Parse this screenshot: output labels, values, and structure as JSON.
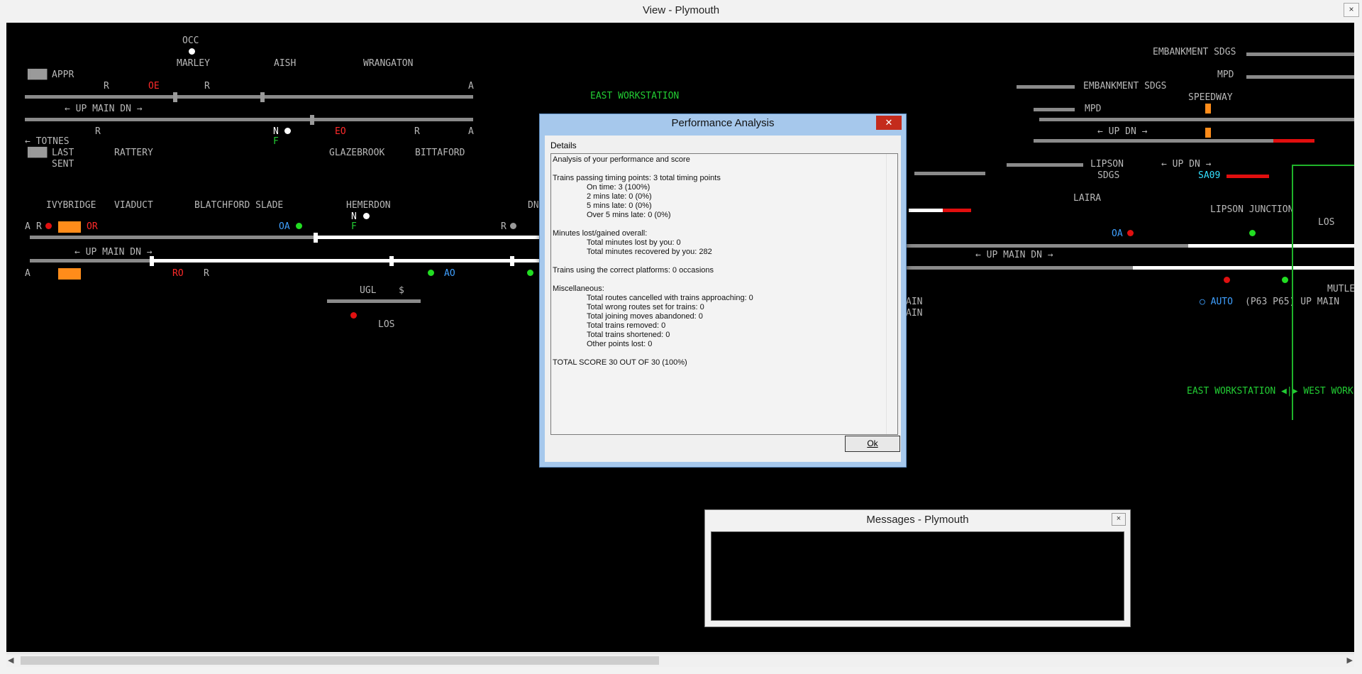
{
  "window": {
    "title": "View - Plymouth",
    "close": "×"
  },
  "map": {
    "labels": {
      "occ": "OCC",
      "marley": "MARLEY",
      "aish": "AISH",
      "wrangaton": "WRANGATON",
      "appr": "APPR",
      "totnes": "← TOTNES",
      "last": "LAST",
      "sent": "SENT",
      "rattery": "RATTERY",
      "glazebrook": "GLAZEBROOK",
      "bittaford": "BITTAFORD",
      "ivybridge": "IVYBRIDGE",
      "viaduct": "VIADUCT",
      "blatchford": "BLATCHFORD SLADE",
      "hemerdon": "HEMERDON",
      "dn": "DN",
      "ugl": "UGL",
      "los1": "LOS",
      "up_main_dn_1": "← UP MAIN DN →",
      "up_main_dn_2": "← UP MAIN DN →",
      "up_main_dn_3": "← UP MAIN DN →",
      "east_ws": "EAST WORKSTATION",
      "embank1": "EMBANKMENT SDGS",
      "mpd1": "MPD",
      "embank2": "EMBANKMENT SDGS",
      "mpd2": "MPD",
      "speedway": "SPEEDWAY",
      "up_dn": "← UP   DN →",
      "up_dn2": "← UP   DN →",
      "lipson": "LIPSON",
      "sdgs": "SDGS",
      "laira": "LAIRA",
      "lipson_junction": "LIPSON JUNCTION",
      "los2": "LOS",
      "mutley": "MUTLEY",
      "main1": "AIN",
      "main2": "AIN",
      "sa09": "SA09",
      "auto": "○ AUTO",
      "auto_rest": "(P63 P65) UP MAIN",
      "ew_ww": "EAST WORKSTATION ◀|▶ WEST WORK",
      "n1": "N",
      "f1": "F",
      "n2": "N",
      "f2": "F",
      "a1": "A",
      "a2": "A",
      "a3": "A",
      "a4": "A",
      "r1": "R",
      "r2": "R",
      "r3": "R",
      "r4": "R",
      "r5": "R",
      "r6": "R",
      "r7": "R",
      "oe": "OE",
      "eo": "EO",
      "or": "OR",
      "ro": "RO",
      "oa1": "OA",
      "ao": "AO",
      "oa2": "OA",
      "dollar": "$"
    }
  },
  "perf": {
    "title": "Performance Analysis",
    "close": "✕",
    "details_label": "Details",
    "ok_label": "Ok",
    "lines": [
      "Analysis of your performance and score",
      "",
      "Trains passing timing points: 3 total timing points",
      "        On time: 3 (100%)",
      "        2 mins late: 0 (0%)",
      "        5 mins late: 0 (0%)",
      "        Over 5 mins late: 0 (0%)",
      "",
      "Minutes lost/gained overall:",
      "        Total minutes lost by you: 0",
      "        Total minutes recovered by you: 282",
      "",
      "Trains using the correct platforms: 0 occasions",
      "",
      "Miscellaneous:",
      "        Total routes cancelled with trains approaching: 0",
      "        Total wrong routes set for trains: 0",
      "        Total joining moves abandoned: 0",
      "        Total trains removed: 0",
      "        Total trains shortened: 0",
      "        Other points lost: 0",
      "",
      "TOTAL SCORE 30 OUT OF 30 (100%)"
    ]
  },
  "messages": {
    "title": "Messages - Plymouth",
    "close": "×"
  }
}
